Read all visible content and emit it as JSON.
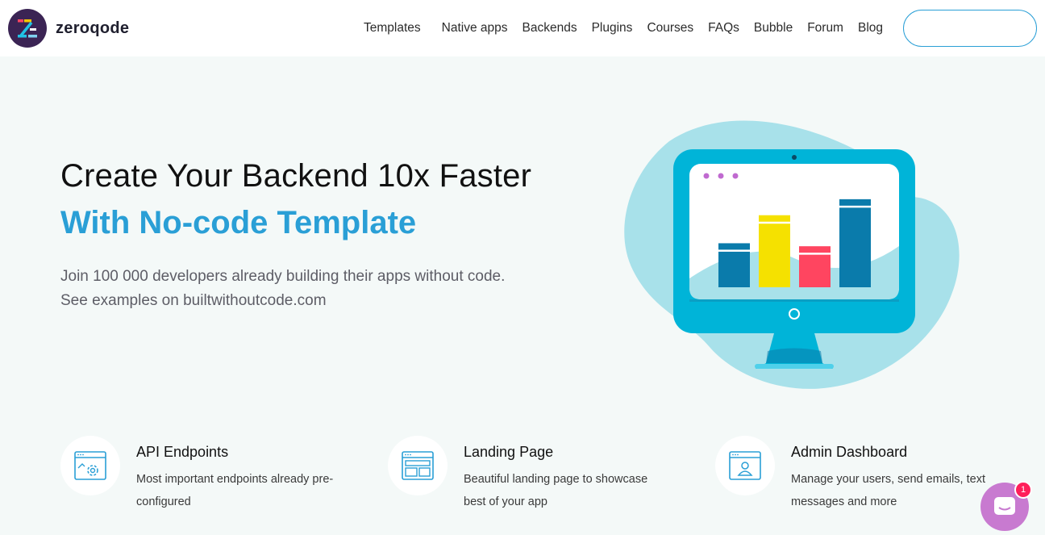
{
  "brand": {
    "name": "zeroqode"
  },
  "nav": {
    "items": [
      {
        "label": "Templates"
      },
      {
        "label": "Native apps"
      },
      {
        "label": "Backends"
      },
      {
        "label": "Plugins"
      },
      {
        "label": "Courses"
      },
      {
        "label": "FAQs"
      },
      {
        "label": "Bubble"
      },
      {
        "label": "Forum"
      },
      {
        "label": "Blog"
      }
    ]
  },
  "hero": {
    "title": "Create Your Backend 10x Faster",
    "subtitle": "With No-code Template",
    "desc_line1": "Join 100 000 developers already building their apps without code.",
    "desc_line2": "See examples on builtwithoutcode.com"
  },
  "illustration": {
    "bars": [
      {
        "value": 0.44,
        "color": "#0a7bab"
      },
      {
        "value": 0.72,
        "color": "#f5e100"
      },
      {
        "value": 0.41,
        "color": "#ff4560"
      },
      {
        "value": 0.88,
        "color": "#0a7bab"
      }
    ]
  },
  "features": [
    {
      "title": "API Endpoints",
      "desc": "Most important endpoints already pre-configured",
      "icon": "api-icon"
    },
    {
      "title": "Landing Page",
      "desc": "Beautiful landing page to showcase best of your app",
      "icon": "landing-icon"
    },
    {
      "title": "Admin Dashboard",
      "desc": "Manage your users, send emails, text messages and more",
      "icon": "admin-icon"
    }
  ],
  "chat": {
    "badge": "1"
  },
  "colors": {
    "accent": "#2a9fd6",
    "monitor": "#00b4d8",
    "blob": "#a8e1ea"
  }
}
